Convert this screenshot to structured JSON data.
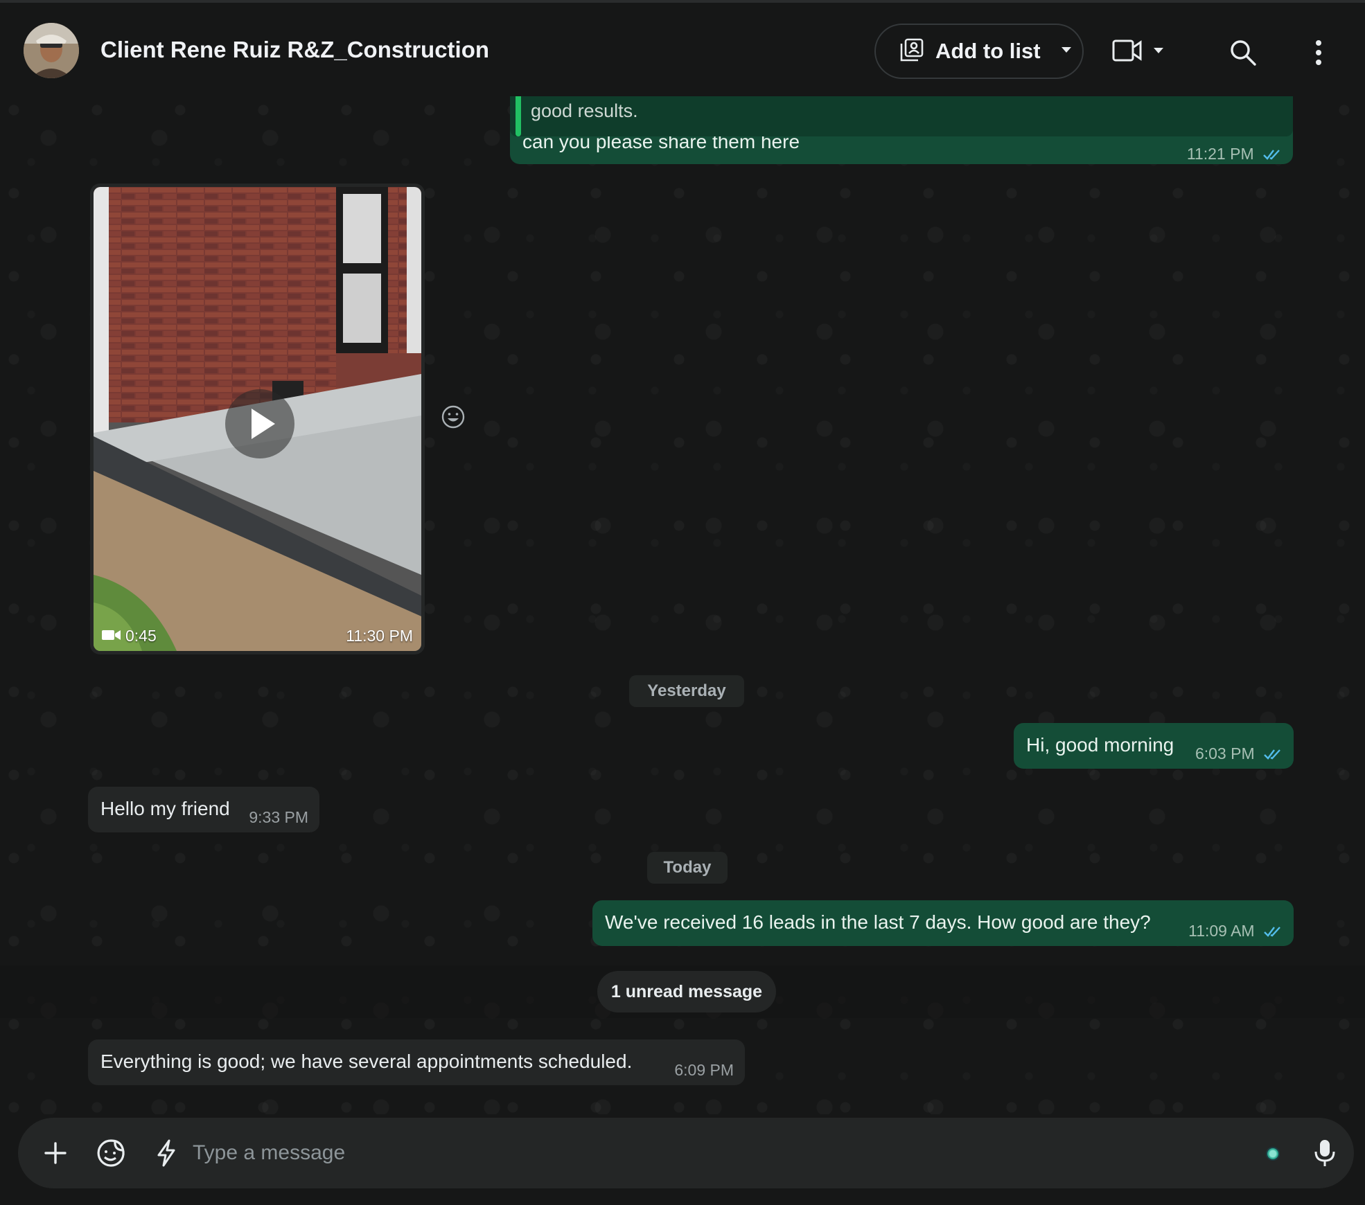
{
  "header": {
    "contact_name": "Client Rene Ruiz R&Z_Construction",
    "add_to_list_label": "Add to list"
  },
  "messages": {
    "quoted_text": "good results.",
    "m1_text": "can you please share them here",
    "m1_time": "11:21 PM",
    "video_duration": "0:45",
    "video_time": "11:30 PM",
    "date_yesterday": "Yesterday",
    "m2_text": "Hi, good morning",
    "m2_time": "6:03 PM",
    "m3_text": "Hello my friend",
    "m3_time": "9:33 PM",
    "date_today": "Today",
    "m4_text": "We've received 16 leads in the last 7 days. How good are they?",
    "m4_time": "11:09 AM",
    "unread_label": "1 unread message",
    "m5_text": "Everything is good; we have several appointments scheduled.",
    "m5_time": "6:09 PM"
  },
  "composer": {
    "placeholder": "Type a message"
  },
  "colors": {
    "outgoing_bubble": "#144d37",
    "incoming_bubble": "#242626",
    "read_ticks": "#53bdeb",
    "background": "#161717"
  },
  "icons": [
    "add-to-list-icon",
    "chevron-down-icon",
    "video-call-icon",
    "search-icon",
    "more-options-icon",
    "double-check-icon",
    "play-icon",
    "video-camera-icon",
    "emoji-react-icon",
    "plus-icon",
    "sticker-icon",
    "lightning-icon",
    "microphone-icon"
  ]
}
